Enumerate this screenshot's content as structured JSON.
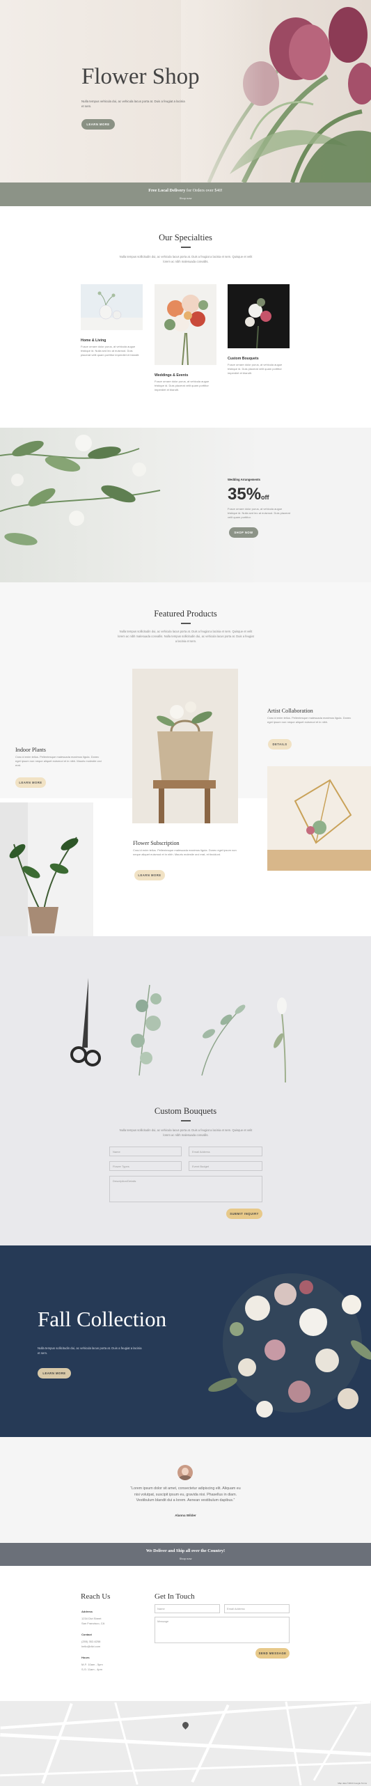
{
  "hero": {
    "title": "Flower Shop",
    "subtitle": "Nulla tempus vehicula dui, ac vehicula lacus porta at. Duis a feugiat a lacinia et sem.",
    "button": "LEARN MORE"
  },
  "delivery_band": {
    "strong": "Free Local Delivery",
    "rest": "for Orders over $40!",
    "link": "Shop now"
  },
  "specialties": {
    "title": "Our Specialties",
    "text": "Nulla tempus sollicitudin dui, ac vehicula lacus porta at. Duis a feugiat a lacinia et sem. Quisque et velit lorem ac nibh malesuada convallis.",
    "cards": [
      {
        "title": "Home & Living",
        "text": "Fusce ornare dolor purus, at vehicula augue tristique id. Nulla sed leo at euismod. Duis placerat velit quam porttitor imperdiet et blandit."
      },
      {
        "title": "Weddings & Events",
        "text": "Fusce ornare dolor purus, at vehicula augue tristique id. Duis placerat velit quam porttitor imperdiet et blandit."
      },
      {
        "title": "Custom Bouquets",
        "text": "Fusce ornare dolor purus, at vehicula augue tristique id. Duis placerat velit quam porttitor imperdiet et blandit."
      }
    ]
  },
  "promo": {
    "kicker": "Wedding Arrangements",
    "big": "35%",
    "off": "off",
    "text": "Fusce ornare dolor purus, at vehicula augue tristique id. Nulla sed leo at euismod. Duis placerat velit quam porttitor.",
    "button": "SHOP NOW"
  },
  "featured": {
    "title": "Featured Products",
    "text": "Nulla tempus sollicitudin dui, ac vehicula lacus porta at. Duis a feugiat a lacinia et sem. Quisque et velit lorem ac nibh malesuada convallis. Nulla tempus sollicitudin dui, ac vehicula lacus porta at. Duis a feugiat a lacinia et sem.",
    "items": [
      {
        "title": "Indoor Plants",
        "text": "Cras id enim tellus. Pellentesque malesuada maximus ligula. Donec eget ipsum non neque aliquet euismod et in nibh. Mauris molestie orci erat.",
        "button": "LEARN MORE"
      },
      {
        "title": "Artist Collaboration",
        "text": "Cras id enim tellus. Pellentesque malesuada maximus ligula. Donec eget ipsum non neque aliquet euismod et in nibh.",
        "button": "DETAILS"
      },
      {
        "title": "Flower Subscription",
        "text": "Cras id enim tellus. Pellentesque malesuada maximus ligula. Donec eget ipsum non neque aliquet euismod et in nibh. Mauris molestie orci erat, et tincidunt.",
        "button": "LEARN MORE"
      }
    ]
  },
  "custom": {
    "title": "Custom Bouquets",
    "text": "Nulla tempus sollicitudin dui, ac vehicula lacus porta at. Duis a feugiat a lacinia et sem. Quisque et velit lorem ac nibh malesuada convallis.",
    "fields": {
      "name": "Name",
      "email": "Email Address",
      "flower": "Flower Types",
      "budget": "Event Budget",
      "desc": "Description/Details"
    },
    "button": "SUBMIT INQUIRY"
  },
  "fall": {
    "title": "Fall Collection",
    "text": "Nulla tempus sollicitudin dui, ac vehicula lacus porta at. Duis a feugiat a lacinia et sem.",
    "button": "LEARN MORE"
  },
  "testimonial": {
    "quote": "“Lorem ipsum dolor sit amet, consectetur adipiscing elit. Aliquam eu nisi volutpat, suscipit ipsum eu, gravida nisi. Phasellus in diam. Vestibulum blandit dui a lorem. Aenean vestibulum dapibus.”",
    "author": "Alanna Wilder"
  },
  "band2": {
    "main": "We Deliver and Ship all over the Country!",
    "link": "Shop now"
  },
  "contact": {
    "reach_title": "Reach Us",
    "address_label": "Address",
    "address_lines": [
      "1234 Divi Street",
      "San Francisco, CA"
    ],
    "contact_label": "Contact",
    "contact_lines": [
      "(255) 352-6258",
      "hello@divi.com"
    ],
    "hours_label": "Hours",
    "hours_lines": [
      "M-F: 10am - 5pm",
      "S-S: 11am - 4pm"
    ],
    "form_title": "Get In Touch",
    "name_ph": "Name",
    "email_ph": "Email Address",
    "message_ph": "Message",
    "button": "SEND MESSAGE"
  },
  "map": {
    "credit": "Map data ©2024 Google  Terms"
  }
}
